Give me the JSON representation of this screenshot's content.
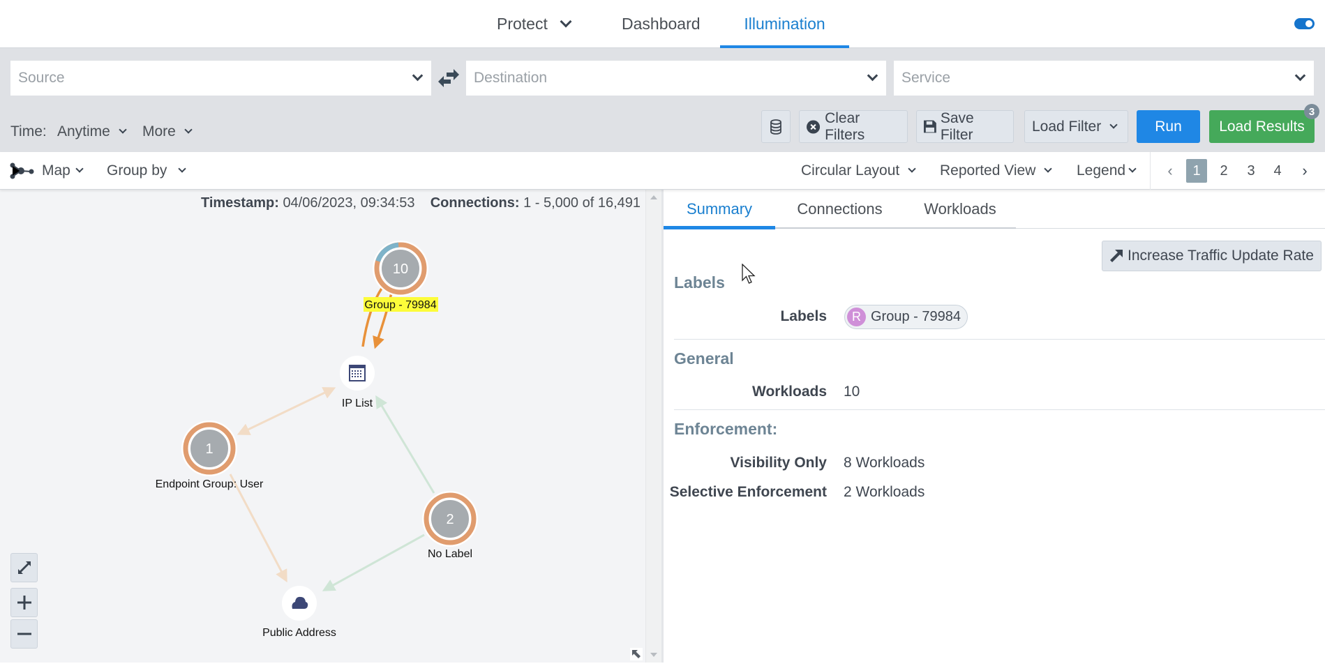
{
  "nav": {
    "items": [
      {
        "label": "Protect",
        "has_dropdown": true,
        "active": false
      },
      {
        "label": "Dashboard",
        "has_dropdown": false,
        "active": false
      },
      {
        "label": "Illumination",
        "has_dropdown": false,
        "active": true
      }
    ],
    "toggle_on": true
  },
  "filters": {
    "source_placeholder": "Source",
    "destination_placeholder": "Destination",
    "service_placeholder": "Service",
    "time_label": "Time:",
    "time_value": "Anytime",
    "more_label": "More",
    "clear_filters": "Clear Filters",
    "save_filter": "Save Filter",
    "load_filter": "Load Filter",
    "run": "Run",
    "load_results": "Load Results",
    "load_results_badge": "3"
  },
  "map_toolbar": {
    "map_label": "Map",
    "group_by_label": "Group by",
    "layout_label": "Circular Layout",
    "view_label": "Reported View",
    "legend_label": "Legend",
    "pages": [
      "1",
      "2",
      "3",
      "4"
    ],
    "current_page": "1"
  },
  "map": {
    "timestamp_label": "Timestamp:",
    "timestamp_value": "04/06/2023, 09:34:53",
    "connections_label": "Connections:",
    "connections_value": "1 - 5,000 of 16,491",
    "nodes": [
      {
        "id": "group",
        "type": "group",
        "count": "10",
        "label": "Group - 79984",
        "highlighted": true,
        "ring": {
          "blue_fraction": 0.2,
          "orange_fraction": 0.8
        }
      },
      {
        "id": "iplist",
        "type": "iplist",
        "label": "IP List"
      },
      {
        "id": "endpoint",
        "type": "group",
        "count": "1",
        "label": "Endpoint Group: User",
        "highlighted": false,
        "ring": {
          "blue_fraction": 0,
          "orange_fraction": 1
        }
      },
      {
        "id": "nolabel",
        "type": "group",
        "count": "2",
        "label": "No Label",
        "highlighted": false,
        "ring": {
          "blue_fraction": 0,
          "orange_fraction": 1
        }
      },
      {
        "id": "public",
        "type": "internet",
        "label": "Public Address"
      }
    ],
    "edges": [
      {
        "from": "iplist",
        "to": "group",
        "color": "#e8913a"
      },
      {
        "from": "group",
        "to": "iplist",
        "color": "#e8913a"
      },
      {
        "from": "endpoint",
        "to": "iplist",
        "color": "#f2dcc6",
        "bidirectional": true
      },
      {
        "from": "endpoint",
        "to": "public",
        "color": "#f2dcc6"
      },
      {
        "from": "nolabel",
        "to": "iplist",
        "color": "#cfe5d6"
      },
      {
        "from": "nolabel",
        "to": "public",
        "color": "#cfe5d6"
      }
    ],
    "colors": {
      "orange_ring": "#e09c6e",
      "blue_ring": "#7eb3c9",
      "node_fill": "#a6abaf",
      "highlight": "#fcfc3a"
    }
  },
  "panel": {
    "tabs": [
      "Summary",
      "Connections",
      "Workloads"
    ],
    "active_tab": "Summary",
    "increase_rate_button": "Increase Traffic Update Rate",
    "labels_section": "Labels",
    "labels_row_label": "Labels",
    "label_chip": {
      "prefix": "R",
      "text": "Group - 79984"
    },
    "general_section": "General",
    "workloads_label": "Workloads",
    "workloads_value": "10",
    "enforcement_section": "Enforcement:",
    "enforcement_rows": [
      {
        "label": "Visibility Only",
        "value": "8 Workloads"
      },
      {
        "label": "Selective Enforcement",
        "value": "2 Workloads"
      }
    ]
  }
}
